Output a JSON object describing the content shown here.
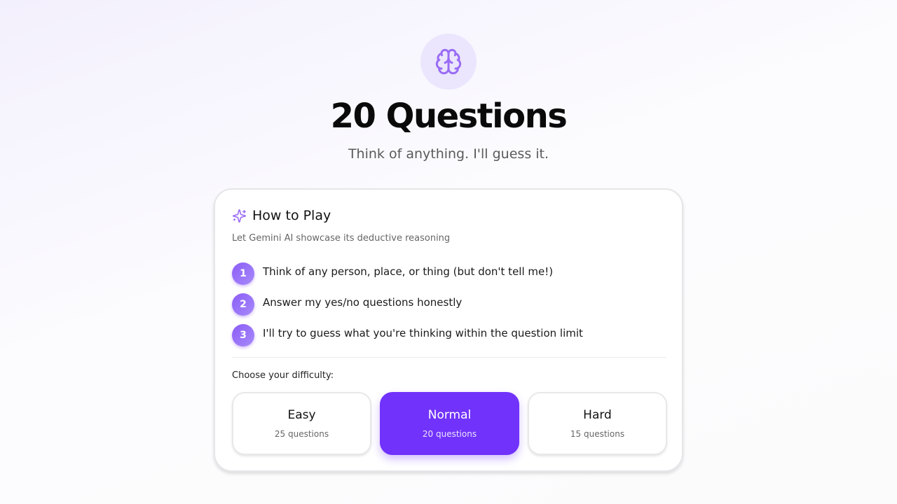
{
  "hero": {
    "icon": "brain-icon",
    "title": "20 Questions",
    "subtitle": "Think of anything. I'll guess it."
  },
  "how_to_play": {
    "icon": "sparkles-icon",
    "title": "How to Play",
    "description": "Let Gemini AI showcase its deductive reasoning",
    "steps": [
      {
        "number": "1",
        "text": "Think of any person, place, or thing (but don't tell me!)"
      },
      {
        "number": "2",
        "text": "Answer my yes/no questions honestly"
      },
      {
        "number": "3",
        "text": "I'll try to guess what you're thinking within the question limit"
      }
    ]
  },
  "difficulty": {
    "label": "Choose your difficulty:",
    "selected": "Normal",
    "options": [
      {
        "name": "Easy",
        "count": "25 questions"
      },
      {
        "name": "Normal",
        "count": "20 questions"
      },
      {
        "name": "Hard",
        "count": "15 questions"
      }
    ]
  },
  "colors": {
    "accent": "#7133fb",
    "accent_light": "#ebe6fd",
    "step_badge": "#8b5cf6"
  }
}
